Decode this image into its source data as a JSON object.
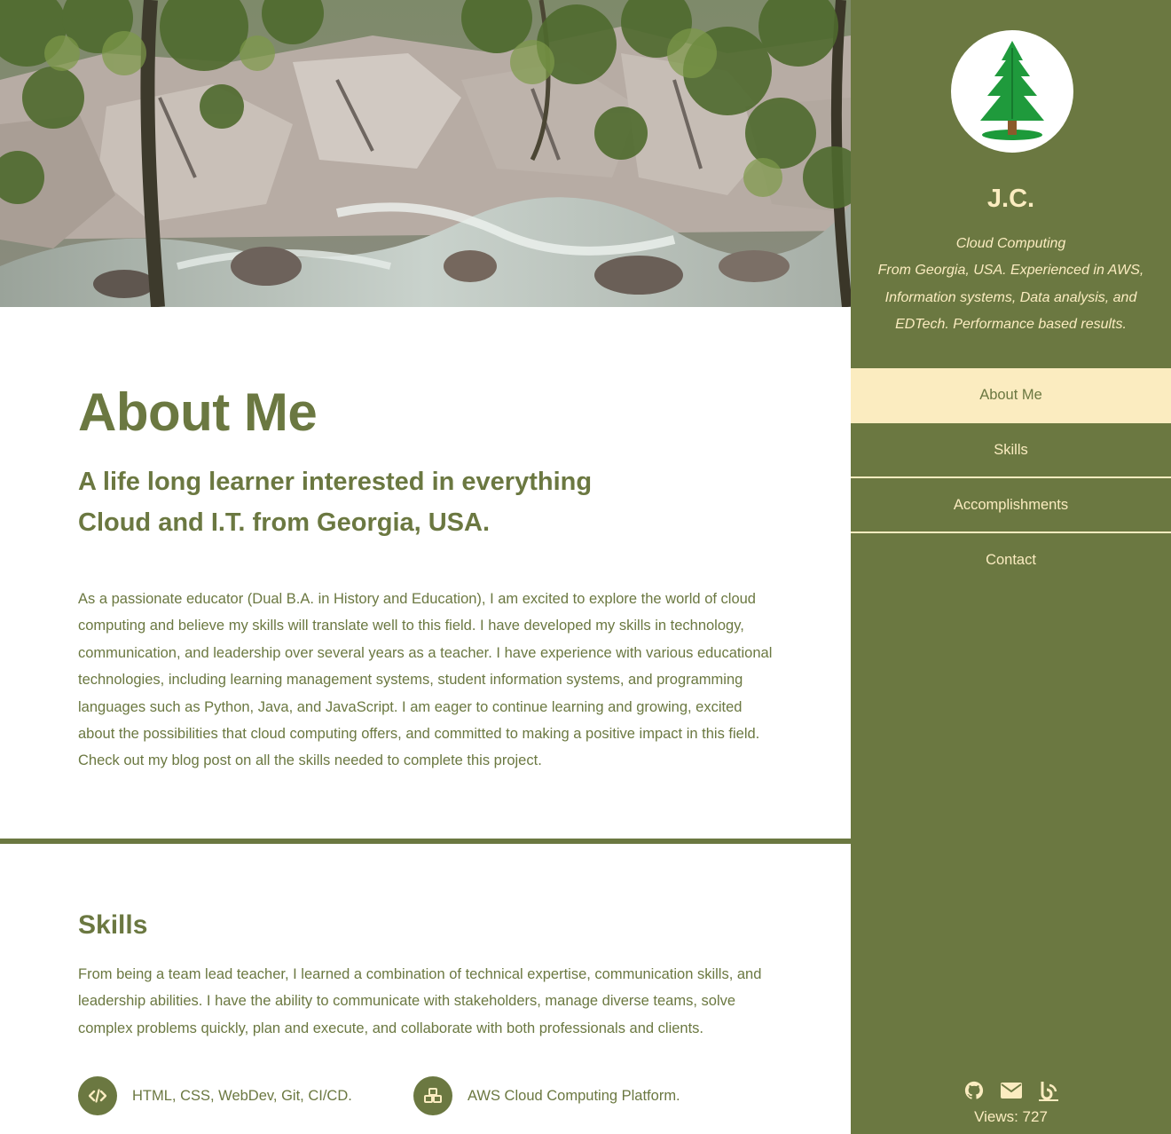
{
  "sidebar": {
    "name": "J.C.",
    "tagline_line1": "Cloud Computing",
    "tagline_line2": "From Georgia, USA. Experienced in AWS, Information systems, Data analysis, and EDTech. Performance based results.",
    "nav": [
      {
        "label": "About Me",
        "active": true
      },
      {
        "label": "Skills",
        "active": false
      },
      {
        "label": "Accomplishments",
        "active": false
      },
      {
        "label": "Contact",
        "active": false
      }
    ],
    "social_icons": [
      "github-icon",
      "email-icon",
      "blog-icon"
    ],
    "views_label": "Views: 727"
  },
  "about": {
    "title": "About Me",
    "subtitle": "A life long learner interested in everything Cloud and I.T. from Georgia, USA.",
    "body": "As a passionate educator (Dual B.A. in History and Education), I am excited to explore the world of cloud computing and believe my skills will translate well to this field. I have developed my skills in technology, communication, and leadership over several years as a teacher. I have experience with various educational technologies, including learning management systems, student information systems, and programming languages such as Python, Java, and JavaScript. I am eager to continue learning and growing, excited about the possibilities that cloud computing offers, and committed to making a positive impact in this field. Check out my blog post on all the skills needed to complete this project."
  },
  "skills": {
    "title": "Skills",
    "body": "From being a team lead teacher, I learned a combination of technical expertise, communication skills, and leadership abilities. I have the ability to communicate with stakeholders, manage diverse teams, solve complex problems quickly, plan and execute, and collaborate with both professionals and clients.",
    "items": [
      {
        "icon": "code-icon",
        "label": "HTML, CSS, WebDev, Git, CI/CD."
      },
      {
        "icon": "cubes-icon",
        "label": "AWS Cloud Computing Platform."
      }
    ]
  },
  "colors": {
    "accent": "#6b7841",
    "cream": "#fbecc0",
    "background": "#ffffff"
  }
}
